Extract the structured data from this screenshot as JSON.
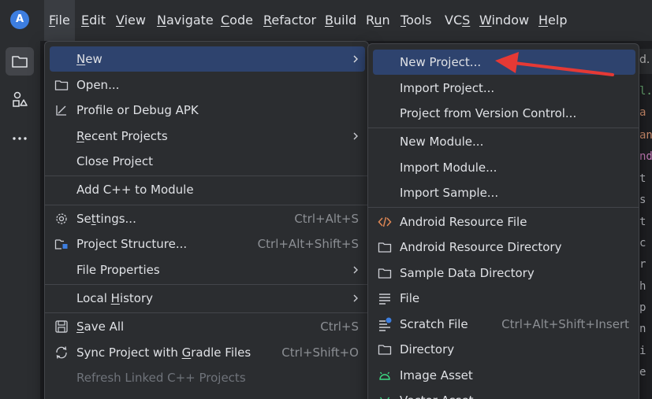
{
  "menubar": {
    "items": [
      {
        "pre": "",
        "u": "F",
        "post": "ile"
      },
      {
        "pre": "",
        "u": "E",
        "post": "dit"
      },
      {
        "pre": "",
        "u": "V",
        "post": "iew"
      },
      {
        "pre": "",
        "u": "N",
        "post": "avigate"
      },
      {
        "pre": "",
        "u": "C",
        "post": "ode"
      },
      {
        "pre": "",
        "u": "R",
        "post": "efactor"
      },
      {
        "pre": "",
        "u": "B",
        "post": "uild"
      },
      {
        "pre": "R",
        "u": "u",
        "post": "n"
      },
      {
        "pre": "",
        "u": "T",
        "post": "ools"
      },
      {
        "pre": "VC",
        "u": "S",
        "post": ""
      },
      {
        "pre": "",
        "u": "W",
        "post": "indow"
      },
      {
        "pre": "",
        "u": "H",
        "post": "elp"
      }
    ]
  },
  "file_menu": {
    "items": [
      {
        "pre": "",
        "u": "N",
        "post": "ew"
      },
      {
        "pre": "",
        "u": "",
        "post": "Open..."
      },
      {
        "pre": "",
        "u": "",
        "post": "Profile or Debug APK"
      },
      {
        "pre": "",
        "u": "R",
        "post": "ecent Projects"
      },
      {
        "pre": "",
        "u": "",
        "post": "Close Project"
      },
      {
        "pre": "",
        "u": "",
        "post": "Add C++ to Module"
      },
      {
        "pre": "Se",
        "u": "t",
        "post": "tings...",
        "shortcut": "Ctrl+Alt+S"
      },
      {
        "pre": "",
        "u": "",
        "post": "Project Structure...",
        "shortcut": "Ctrl+Alt+Shift+S"
      },
      {
        "pre": "",
        "u": "",
        "post": "File Properties"
      },
      {
        "pre": "Local ",
        "u": "H",
        "post": "istory"
      },
      {
        "pre": "",
        "u": "S",
        "post": "ave All",
        "shortcut": "Ctrl+S"
      },
      {
        "pre": "Sync Project with ",
        "u": "G",
        "post": "radle Files",
        "shortcut": "Ctrl+Shift+O"
      },
      {
        "pre": "",
        "u": "",
        "post": "Refresh Linked C++ Projects"
      }
    ]
  },
  "new_submenu": {
    "items": [
      {
        "label": "New Project..."
      },
      {
        "label": "Import Project..."
      },
      {
        "label": "Project from Version Control..."
      },
      {
        "label": "New Module..."
      },
      {
        "label": "Import Module..."
      },
      {
        "label": "Import Sample..."
      },
      {
        "label": "Android Resource File"
      },
      {
        "label": "Android Resource Directory"
      },
      {
        "label": "Sample Data Directory"
      },
      {
        "label": "File"
      },
      {
        "label": "Scratch File",
        "shortcut": "Ctrl+Alt+Shift+Insert"
      },
      {
        "label": "Directory"
      },
      {
        "label": "Image Asset"
      },
      {
        "label": "Vector Asset"
      }
    ]
  },
  "editor": {
    "tab_label": "d.",
    "lines": [
      "l.",
      "a",
      "an",
      "nd",
      "t",
      "s",
      "t",
      "c",
      "r",
      "h",
      "p",
      "n",
      "i",
      "e"
    ]
  },
  "colors": {
    "accent": "#2e436e",
    "annotation_arrow": "#e53935"
  }
}
